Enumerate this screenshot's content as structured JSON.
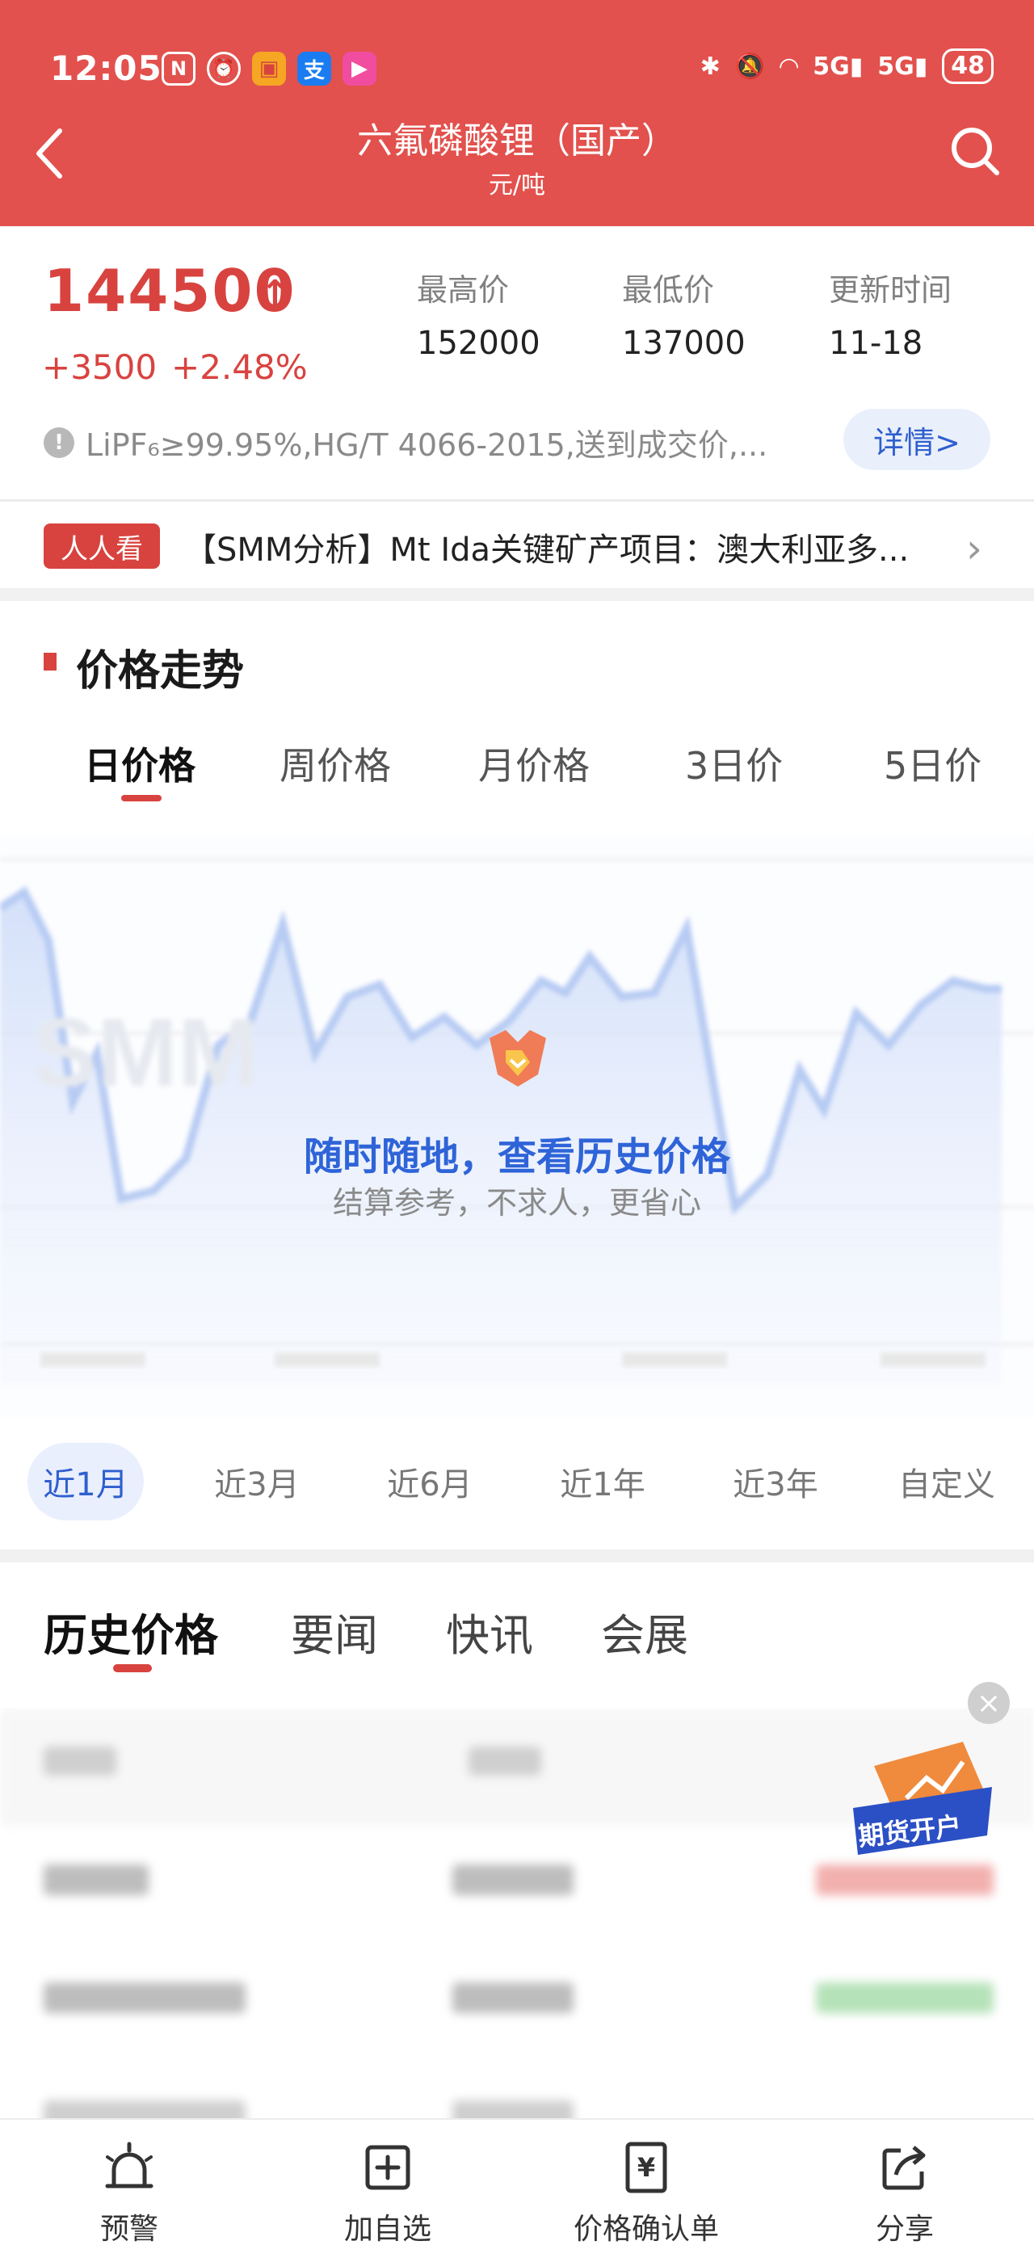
{
  "status_bar": {
    "time": "12:05",
    "signal_1": "5G",
    "signal_2": "5G",
    "battery": "48"
  },
  "header": {
    "title": "六氟磷酸锂（国产）",
    "unit": "元/吨"
  },
  "price": {
    "current": "144500",
    "arrow": "↑",
    "change": "+3500",
    "change_pct": "+2.48%",
    "high_label": "最高价",
    "high_value": "152000",
    "low_label": "最低价",
    "low_value": "137000",
    "update_label": "更新时间",
    "update_value": "11-18",
    "spec": "LiPF₆≥99.95%,HG/T 4066-2015,送到成交价,...",
    "detail_button": "详情>"
  },
  "news": {
    "badge": "人人看",
    "headline": "【SMM分析】Mt Ida关键矿产项目：澳大利亚多..."
  },
  "trend": {
    "section_title": "价格走势",
    "tabs": [
      "日价格",
      "周价格",
      "月价格",
      "3日价",
      "5日价"
    ],
    "active_tab": 0,
    "overlay_title": "随时随地，查看历史价格",
    "overlay_subtitle": "结算参考，不求人，更省心"
  },
  "ranges": {
    "items": [
      "近1月",
      "近3月",
      "近6月",
      "近1年",
      "近3年",
      "自定义"
    ],
    "active": 0
  },
  "lower_tabs": {
    "items": [
      "历史价格",
      "要闻",
      "快讯",
      "会展"
    ],
    "active": 0
  },
  "ad": {
    "label": "期货开户"
  },
  "bottom_nav": {
    "items": [
      "预警",
      "加自选",
      "价格确认单",
      "分享"
    ]
  },
  "colors": {
    "brand_red": "#e2514d",
    "price_red": "#d8433f",
    "link_blue": "#2f5fcf"
  }
}
